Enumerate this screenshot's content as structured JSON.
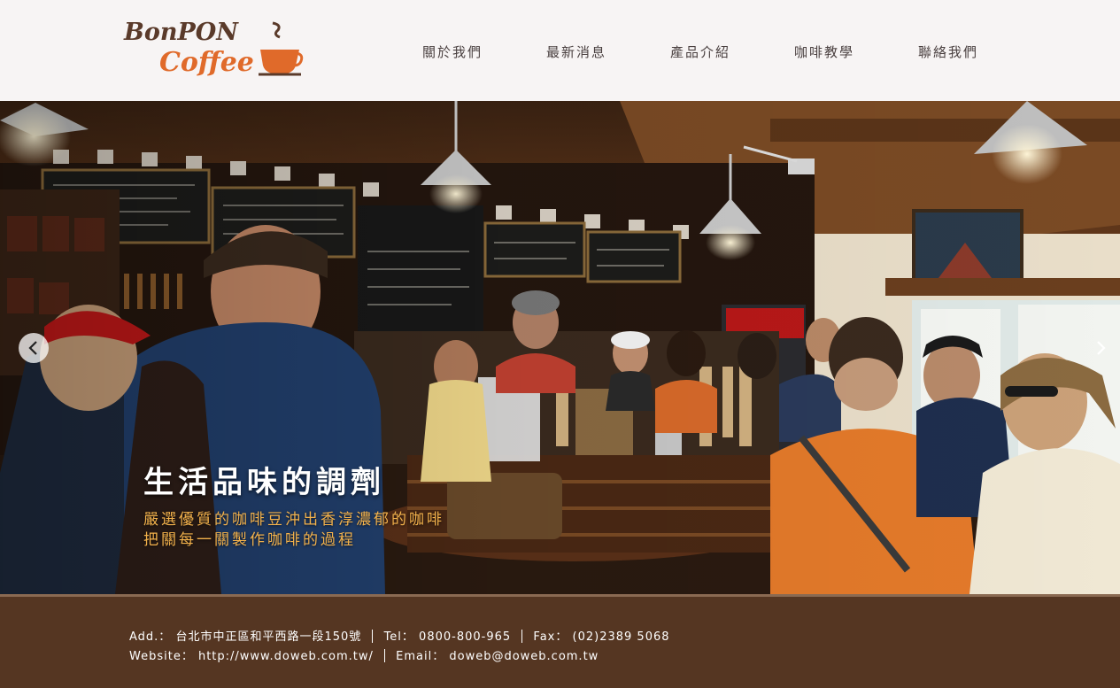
{
  "brand": {
    "logo_line1": "BonPON",
    "logo_line2": "Coffee",
    "logo_color_dark": "#5a3a2a",
    "logo_color_accent": "#e06a2a"
  },
  "nav": {
    "items": [
      "關於我們",
      "最新消息",
      "產品介紹",
      "咖啡教學",
      "聯絡我們"
    ]
  },
  "hero": {
    "title": "生活品味的調劑",
    "subtitle_line1": "嚴選優質的咖啡豆沖出香淳濃郁的咖啡",
    "subtitle_line2": "把關每一關製作咖啡的過程",
    "prev_icon": "chevron-left-icon",
    "next_icon": "chevron-right-icon",
    "subtitle_color": "#f3b24c"
  },
  "footer": {
    "address_label": "Add.：",
    "address": "台北市中正區和平西路一段150號",
    "tel_label": "Tel：",
    "tel": "0800-800-965",
    "fax_label": "Fax：",
    "fax": "(02)2389 5068",
    "website_label": "Website：",
    "website": "http://www.doweb.com.tw/",
    "email_label": "Email：",
    "email": "doweb@doweb.com.tw",
    "background": "#553622"
  }
}
